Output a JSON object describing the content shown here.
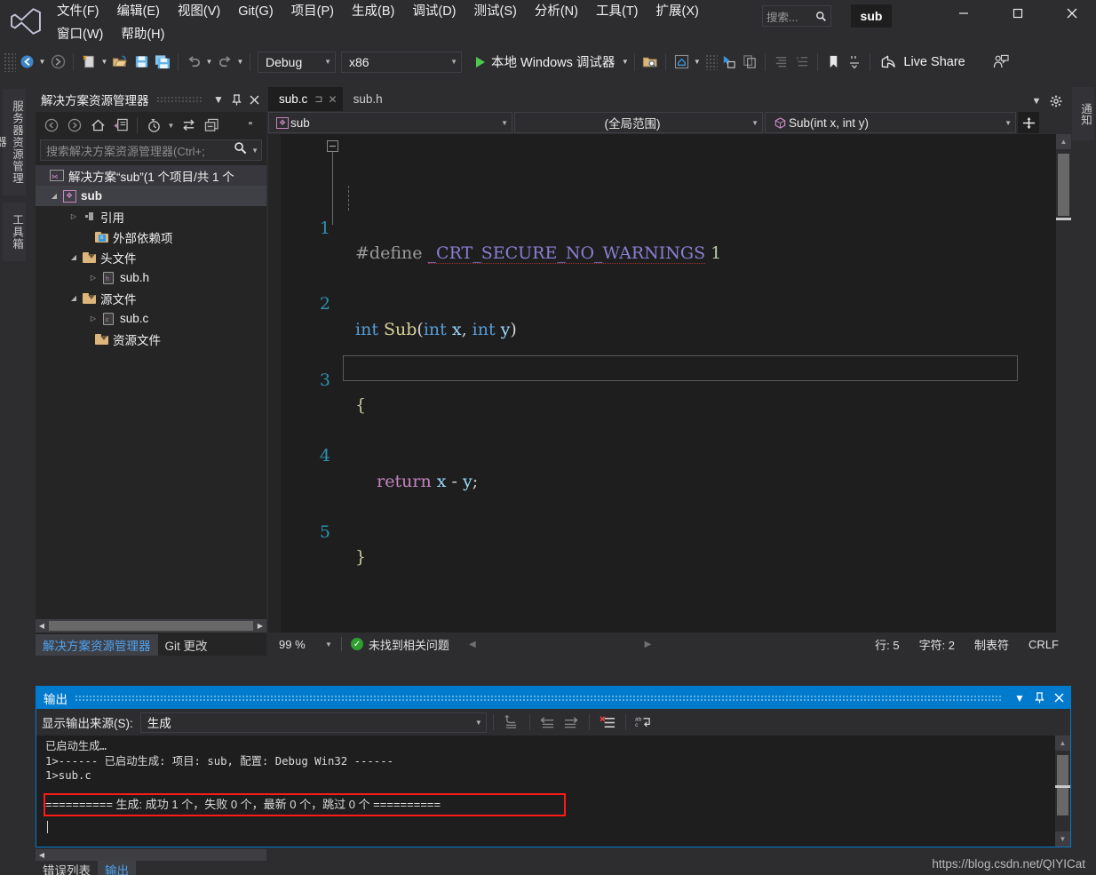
{
  "titlebar": {
    "logo_icon": "visual-studio-logo",
    "menus": [
      {
        "label": "文件(F)",
        "key": "F"
      },
      {
        "label": "编辑(E)",
        "key": "E"
      },
      {
        "label": "视图(V)",
        "key": "V"
      },
      {
        "label": "Git(G)",
        "key": "G"
      },
      {
        "label": "项目(P)",
        "key": "P"
      },
      {
        "label": "生成(B)",
        "key": "B"
      },
      {
        "label": "调试(D)",
        "key": "D"
      },
      {
        "label": "测试(S)",
        "key": "S"
      },
      {
        "label": "分析(N)",
        "key": "N"
      },
      {
        "label": "工具(T)",
        "key": "T"
      },
      {
        "label": "扩展(X)",
        "key": "X"
      },
      {
        "label": "窗口(W)",
        "key": "W"
      },
      {
        "label": "帮助(H)",
        "key": "H"
      }
    ],
    "search_placeholder": "搜索...",
    "search_icon": "magnifier-icon",
    "project_badge": "sub",
    "minimize_label": "—",
    "maximize_label": "□",
    "close_label": "✕"
  },
  "toolbar": {
    "back_icon": "navigate-back-icon",
    "forward_icon": "navigate-forward-icon",
    "new_file_icon": "new-file-icon",
    "open_file_icon": "open-folder-icon",
    "save_icon": "save-icon",
    "save_all_icon": "save-all-icon",
    "undo_icon": "undo-icon",
    "redo_icon": "redo-icon",
    "config_value": "Debug",
    "platform_value": "x86",
    "run_label": "本地 Windows 调试器",
    "search_folder_icon": "folder-search-icon",
    "home_box_icon": "home-box-icon",
    "pointer_icon": "pointer-select-icon",
    "copy_icon": "copy-icon",
    "indent_icon": "indent-icon",
    "comment_icon": "comment-icon",
    "bookmark_icon": "bookmark-icon",
    "liveshare_icon": "live-share-icon",
    "liveshare_label": "Live Share",
    "feedback_icon": "feedback-person-icon"
  },
  "left_rail": {
    "server_explorer": "服务器资源管理器",
    "toolbox": "工具箱"
  },
  "right_rail": {
    "notifications": "通知"
  },
  "solution_explorer": {
    "title": "解决方案资源管理器",
    "dropdown_icon": "chevron-down-icon",
    "pin_icon": "pin-icon",
    "close_icon": "close-icon",
    "toolbar": {
      "back_icon": "back-arrow-icon",
      "forward_icon": "forward-arrow-icon",
      "home_icon": "home-icon",
      "sync_view_icon": "sync-with-active-document-icon",
      "pending_icon": "pending-changes-clock-icon",
      "refresh_icon": "refresh-swap-icon",
      "collapse_icon": "collapse-all-icon",
      "overflow_icon": "overflow-chevrons-icon"
    },
    "search_placeholder": "搜索解决方案资源管理器(Ctrl+;",
    "search_icon": "magnifier-icon",
    "search_caret_icon": "chevron-down-icon",
    "tree": [
      {
        "label": "解决方案“sub”(1 个项目/共 1 个",
        "icon": "solution-icon",
        "indent": 0,
        "arrow": "",
        "bold": false
      },
      {
        "label": "sub",
        "icon": "project-icon",
        "indent": 1,
        "arrow": "◢",
        "bold": true
      },
      {
        "label": "引用",
        "icon": "references-icon",
        "indent": 2,
        "arrow": "▷",
        "bold": false
      },
      {
        "label": "外部依赖项",
        "icon": "external-deps-folder-icon",
        "indent": 3,
        "arrow": "",
        "bold": false
      },
      {
        "label": "头文件",
        "icon": "filter-folder-icon",
        "indent": 2,
        "arrow": "◢",
        "bold": false
      },
      {
        "label": "sub.h",
        "icon": "header-file-icon",
        "indent": 3,
        "arrow": "▷",
        "bold": false
      },
      {
        "label": "源文件",
        "icon": "filter-folder-icon",
        "indent": 2,
        "arrow": "◢",
        "bold": false
      },
      {
        "label": "sub.c",
        "icon": "c-file-icon",
        "indent": 3,
        "arrow": "▷",
        "bold": false
      },
      {
        "label": "资源文件",
        "icon": "filter-folder-icon",
        "indent": 3,
        "arrow": "",
        "bold": false
      }
    ],
    "hscroll_left_icon": "scroll-left-icon",
    "hscroll_right_icon": "scroll-right-icon",
    "tabs": [
      {
        "label": "解决方案资源管理器",
        "active": true
      },
      {
        "label": "Git 更改",
        "active": false
      }
    ]
  },
  "editor": {
    "tabs": [
      {
        "label": "sub.c",
        "active": true,
        "pin_icon": "pin-icon",
        "close_icon": "close-icon"
      },
      {
        "label": "sub.h",
        "active": false
      }
    ],
    "tab_overflow_icon": "chevron-down-icon",
    "tab_settings_icon": "gear-icon",
    "nav_scope": "sub",
    "nav_scope_icon": "project-icon",
    "nav_global": "(全局范围)",
    "nav_member": "Sub(int x, int y)",
    "nav_member_icon": "method-cube-icon",
    "nav_split_icon": "split-view-icon",
    "fold_icon": "collapse-minus-icon",
    "lines": [
      {
        "n": "1",
        "text": "#define _CRT_SECURE_NO_WARNINGS 1"
      },
      {
        "n": "2",
        "text": "int Sub(int x, int y)"
      },
      {
        "n": "3",
        "text": "{"
      },
      {
        "n": "4",
        "text": "    return x - y;"
      },
      {
        "n": "5",
        "text": "}"
      }
    ],
    "scroll_up_icon": "scroll-up-icon",
    "scroll_down_icon": "scroll-down-icon",
    "status": {
      "zoom": "99 %",
      "zoom_caret_icon": "chevron-down-icon",
      "issue_icon": "check-circle-icon",
      "issue_text": "未找到相关问题",
      "prev_issue_icon": "previous-issue-icon",
      "next_issue_icon": "next-issue-icon",
      "line": "行: 5",
      "col": "字符: 2",
      "tabs_mode": "制表符",
      "eol": "CRLF"
    }
  },
  "output_panel": {
    "title": "输出",
    "dropdown_icon": "chevron-down-icon",
    "pin_icon": "pin-icon",
    "close_icon": "close-icon",
    "source_label": "显示输出来源(S):",
    "source_value": "生成",
    "source_caret_icon": "chevron-down-icon",
    "tools": {
      "goto_icon": "go-to-message-icon",
      "prev_icon": "previous-message-icon",
      "next_icon": "next-message-icon",
      "clear_icon": "clear-all-icon",
      "wordwrap_icon": "toggle-word-wrap-icon"
    },
    "lines": [
      "已启动生成…",
      "1>------ 已启动生成: 项目: sub, 配置: Debug Win32 ------",
      "1>sub.c",
      "========== 生成: 成功 1 个，失败 0 个，最新 0 个，跳过 0 个 =========="
    ],
    "highlight_color": "#ff1a1a",
    "highlight_line_index": 3,
    "scroll_up_icon": "scroll-up-icon",
    "scroll_down_icon": "scroll-down-icon"
  },
  "bottom_dock": {
    "scroll_left_icon": "scroll-left-icon",
    "tabs": [
      {
        "label": "错误列表",
        "active": false
      },
      {
        "label": "输出",
        "active": true
      }
    ]
  },
  "watermark": "https://blog.csdn.net/QIYICat",
  "colors": {
    "accent": "#007acc",
    "chrome": "#2d2d30",
    "panel": "#252526",
    "editor_bg": "#1e1e1e",
    "line_number": "#2b91af",
    "keyword": "#569cd6",
    "function": "#d9d29a",
    "macro": "#8a7fd4",
    "number": "#b5cea8",
    "control_keyword": "#c586c0",
    "highlight_red": "#ff1a1a",
    "link_blue": "#4ea4f0"
  }
}
